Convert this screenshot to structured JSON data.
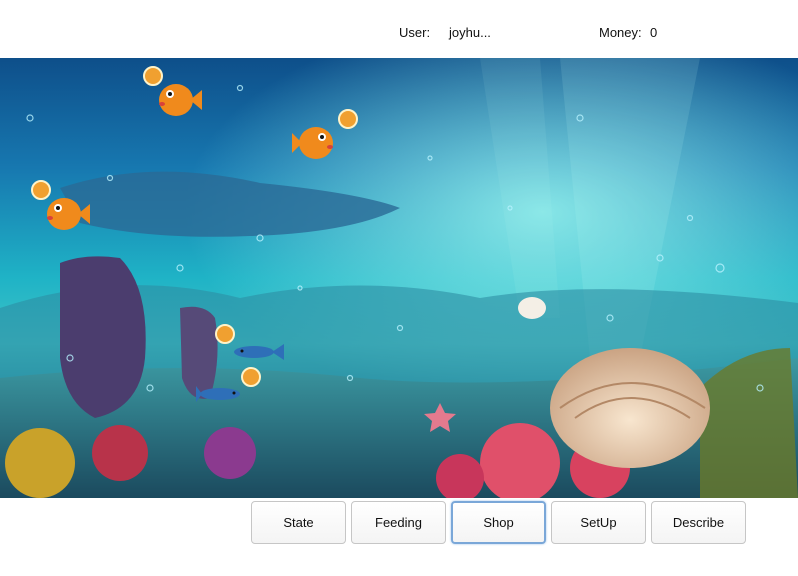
{
  "header": {
    "user_label": "User:",
    "user_value": "joyhu...",
    "money_label": "Money:",
    "money_value": "0"
  },
  "toolbar": {
    "buttons": [
      {
        "label": "State"
      },
      {
        "label": "Feeding"
      },
      {
        "label": "Shop"
      },
      {
        "label": "SetUp"
      },
      {
        "label": "Describe"
      }
    ],
    "focused_button": "Shop"
  },
  "scene": {
    "fish": [
      {
        "kind": "orange-pufferfish",
        "has_coin": true
      },
      {
        "kind": "orange-pufferfish",
        "has_coin": true
      },
      {
        "kind": "orange-pufferfish",
        "has_coin": true
      },
      {
        "kind": "blue-fish",
        "has_coin": true
      },
      {
        "kind": "blue-fish",
        "has_coin": true
      }
    ],
    "colors": {
      "water_deep": "#0e4f8a",
      "water_light": "#3fc3c7",
      "fish_orange": "#f08a1c",
      "fish_blue": "#2e6fb8",
      "coin": "#f0a030"
    }
  }
}
